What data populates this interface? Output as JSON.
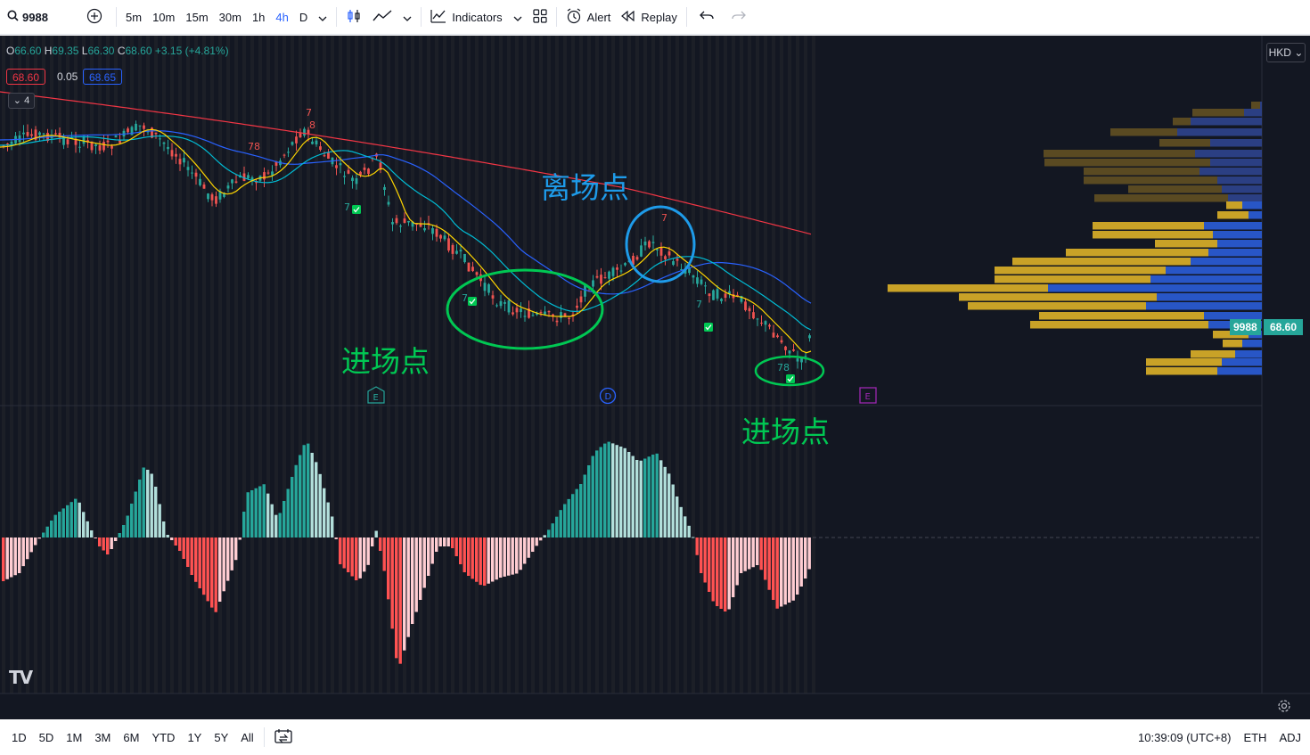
{
  "toolbar": {
    "symbol": "9988",
    "add_icon": "plus-circle-icon",
    "intervals": [
      "5m",
      "10m",
      "15m",
      "30m",
      "1h",
      "4h",
      "D"
    ],
    "active_interval": "4h",
    "indicators_label": "Indicators",
    "alert_label": "Alert",
    "replay_label": "Replay"
  },
  "legend": {
    "o_label": "O",
    "o": "66.60",
    "h_label": "H",
    "h": "69.35",
    "l_label": "L",
    "l": "66.30",
    "c_label": "C",
    "c": "68.60",
    "change": "+3.15 (+4.81%)",
    "bid": "68.60",
    "spread": "0.05",
    "ask": "68.65",
    "collapsed_count": "4"
  },
  "price_scale": {
    "currency": "HKD",
    "symbol_tag": "9988",
    "last_price": "68.60"
  },
  "annotations": {
    "exit": "离场点",
    "entry1": "进场点",
    "entry2": "进场点"
  },
  "markers": {
    "event_e1": "E",
    "event_d": "D",
    "event_e2": "E",
    "label_7a": "7",
    "label_78a": "78",
    "label_8a": "8",
    "label_7b": "7",
    "label_7c": "7",
    "label_7d": "7",
    "label_7e": "7",
    "label_78b": "78"
  },
  "colors": {
    "up": "#26a69a",
    "down": "#ef5350",
    "entry_green": "#00c853",
    "exit_blue": "#1e9be9",
    "ma_red": "#f23645",
    "ma_blue": "#2962ff",
    "ma_teal": "#00bcd4",
    "ma_yellow": "#ffd600",
    "vp_gold": "#c9a227",
    "vp_blue": "#2856c6"
  },
  "bottom": {
    "ranges": [
      "1D",
      "5D",
      "1M",
      "3M",
      "6M",
      "YTD",
      "1Y",
      "5Y",
      "All"
    ],
    "time": "10:39:09 (UTC+8)",
    "session": "ETH",
    "adj": "ADJ"
  }
}
